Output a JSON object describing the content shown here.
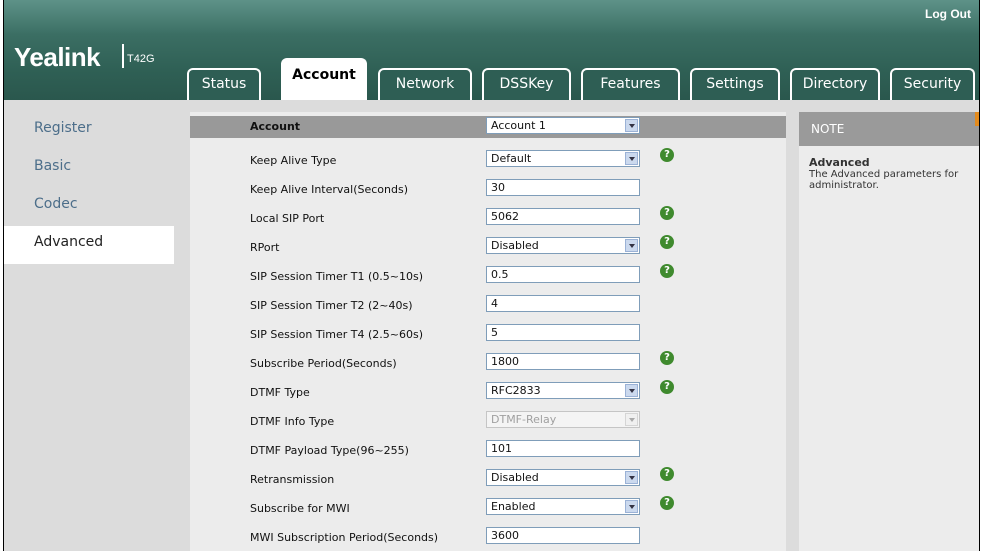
{
  "header": {
    "logout_label": "Log Out",
    "brand": "Yealink",
    "model": "T42G"
  },
  "tabs": [
    {
      "label": "Status",
      "active": false
    },
    {
      "label": "Account",
      "active": true
    },
    {
      "label": "Network",
      "active": false
    },
    {
      "label": "DSSKey",
      "active": false
    },
    {
      "label": "Features",
      "active": false
    },
    {
      "label": "Settings",
      "active": false
    },
    {
      "label": "Directory",
      "active": false
    },
    {
      "label": "Security",
      "active": false
    }
  ],
  "sidebar": {
    "items": [
      {
        "label": "Register",
        "active": false
      },
      {
        "label": "Basic",
        "active": false
      },
      {
        "label": "Codec",
        "active": false
      },
      {
        "label": "Advanced",
        "active": true
      }
    ]
  },
  "form": {
    "header": {
      "label": "Account",
      "value": "Account 1"
    },
    "rows": [
      {
        "label": "Keep Alive Type",
        "type": "select",
        "value": "Default",
        "help": true
      },
      {
        "label": "Keep Alive Interval(Seconds)",
        "type": "input",
        "value": "30",
        "help": false
      },
      {
        "label": "Local SIP Port",
        "type": "input",
        "value": "5062",
        "help": true
      },
      {
        "label": "RPort",
        "type": "select",
        "value": "Disabled",
        "help": true
      },
      {
        "label": "SIP Session Timer T1 (0.5~10s)",
        "type": "input",
        "value": "0.5",
        "help": true
      },
      {
        "label": "SIP Session Timer T2 (2~40s)",
        "type": "input",
        "value": "4",
        "help": false
      },
      {
        "label": "SIP Session Timer T4 (2.5~60s)",
        "type": "input",
        "value": "5",
        "help": false
      },
      {
        "label": "Subscribe Period(Seconds)",
        "type": "input",
        "value": "1800",
        "help": true
      },
      {
        "label": "DTMF Type",
        "type": "select",
        "value": "RFC2833",
        "help": true
      },
      {
        "label": "DTMF Info Type",
        "type": "select-disabled",
        "value": "DTMF-Relay",
        "help": false
      },
      {
        "label": "DTMF Payload Type(96~255)",
        "type": "input",
        "value": "101",
        "help": false
      },
      {
        "label": "Retransmission",
        "type": "select",
        "value": "Disabled",
        "help": true
      },
      {
        "label": "Subscribe for MWI",
        "type": "select",
        "value": "Enabled",
        "help": true
      },
      {
        "label": "MWI Subscription Period(Seconds)",
        "type": "input",
        "value": "3600",
        "help": false
      }
    ]
  },
  "note": {
    "header": "NOTE",
    "title": "Advanced",
    "text": "The Advanced parameters for administrator."
  },
  "icons": {
    "help": "help-icon",
    "dropdown": "chevron-down-icon"
  },
  "colors": {
    "topbar": "#2f6055",
    "help_icon": "#3f8a2e",
    "note_flag": "#e38b1e",
    "sidebar_link": "#4c6e8a"
  }
}
